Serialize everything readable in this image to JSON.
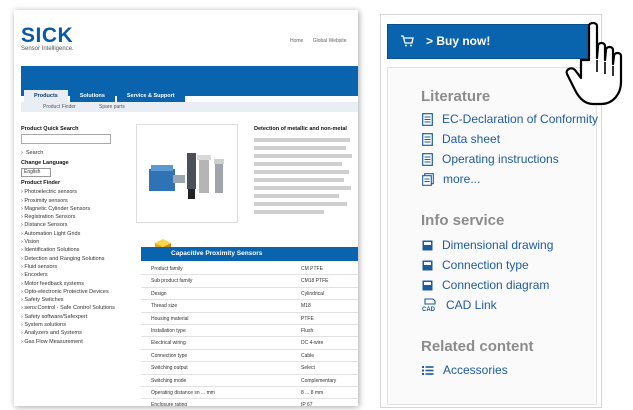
{
  "left_page": {
    "logo": "SICK",
    "logo_tagline": "Sensor Intelligence.",
    "top_links": [
      "Home",
      "Global Website"
    ],
    "tabs": [
      "Products",
      "Solutions",
      "Service & Support"
    ],
    "subnav": [
      "Product Finder",
      "Spare parts"
    ],
    "sidebar": {
      "quick_search": "Product Quick Search",
      "search": "Search",
      "change_language": "Change Language",
      "language": "English",
      "finder_title": "Product Finder",
      "finder_items": [
        "Photoelectric sensors",
        "Proximity sensors",
        "Magnetic Cylinder Sensors",
        "Registration Sensors",
        "Distance Sensors",
        "Automation Light Grids",
        "Vision",
        "Identification Solutions",
        "Detection and Ranging Solutions",
        "Fluid sensors",
        "Encoders",
        "Motor feedback systems",
        "Opto-electronic Protective Devices",
        "Safety Switches",
        "sens:Control - Safe Control Solutions",
        "Safety software/Safexpert",
        "System solutions",
        "Analyzers and Systems",
        "Gas Flow Measurement"
      ]
    },
    "description_title": "Detection of metallic and non-metal",
    "section_title": "Capacitive Proximity Sensors",
    "specs": [
      {
        "key": "Product family",
        "value": "CM PTFE"
      },
      {
        "key": "Sub product family",
        "value": "CM18 PTFE"
      },
      {
        "key": "Design",
        "value": "Cylindrical"
      },
      {
        "key": "Thread size",
        "value": "M18"
      },
      {
        "key": "Housing material",
        "value": "PTFE"
      },
      {
        "key": "Installation type",
        "value": "Flush"
      },
      {
        "key": "Electrical wiring",
        "value": "DC 4-wire"
      },
      {
        "key": "Connection type",
        "value": "Cable"
      },
      {
        "key": "Switching output",
        "value": "Select"
      },
      {
        "key": "Switching mode",
        "value": "Complementary"
      },
      {
        "key": "Operating distance sn ... mm",
        "value": "8 ... 8 mm"
      },
      {
        "key": "Enclosure rating",
        "value": "IP 67"
      }
    ]
  },
  "right_panel": {
    "buy_label": "> Buy now!",
    "literature": {
      "title": "Literature",
      "items": [
        "EC-Declaration of Conformity",
        "Data sheet",
        "Operating instructions",
        "more..."
      ]
    },
    "info_service": {
      "title": "Info service",
      "items": [
        "Dimensional drawing",
        "Connection type",
        "Connection diagram",
        "CAD Link"
      ]
    },
    "related_content": {
      "title": "Related content",
      "items": [
        "Accessories"
      ]
    }
  },
  "colors": {
    "brand_blue": "#0a63ad",
    "link_blue": "#1e5b9e",
    "section_gray": "#8c8c8c",
    "accent_yellow": "#f0c020"
  },
  "icons": {
    "buy": "cart-icon",
    "document": "document-icon",
    "more": "documents-icon",
    "square": "filled-square-icon",
    "cad": "cad-icon",
    "list": "list-icon",
    "pointer": "hand-pointer-icon"
  }
}
